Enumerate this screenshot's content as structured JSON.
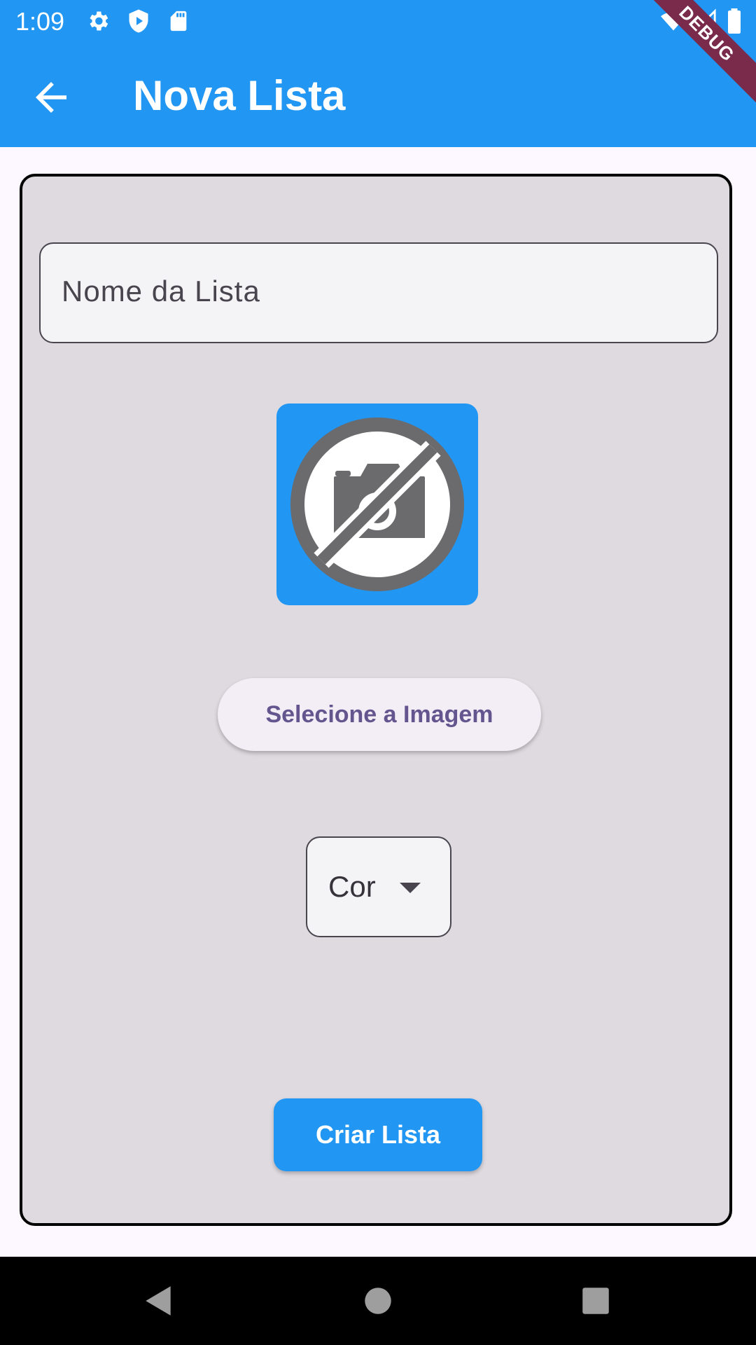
{
  "status_bar": {
    "time": "1:09",
    "icons": [
      "gear-icon",
      "shield-play-icon",
      "sd-card-icon",
      "wifi-icon",
      "signal-icon",
      "battery-icon"
    ]
  },
  "app_bar": {
    "title": "Nova Lista",
    "back_icon": "arrow-back-icon",
    "background": "#2196f3"
  },
  "debug_banner": {
    "label": "DEBUG"
  },
  "form": {
    "name_field": {
      "placeholder": "Nome da Lista",
      "value": ""
    },
    "image": {
      "icon": "no-photography-icon",
      "background": "#2196f3"
    },
    "select_image_button": {
      "label": "Selecione a Imagem"
    },
    "color_dropdown": {
      "label": "Cor",
      "icon": "arrow-drop-down-icon"
    },
    "create_button": {
      "label": "Criar Lista",
      "background": "#2196f3"
    }
  },
  "nav_bar": {
    "icons": [
      "back-triangle-icon",
      "home-circle-icon",
      "recents-square-icon"
    ]
  }
}
